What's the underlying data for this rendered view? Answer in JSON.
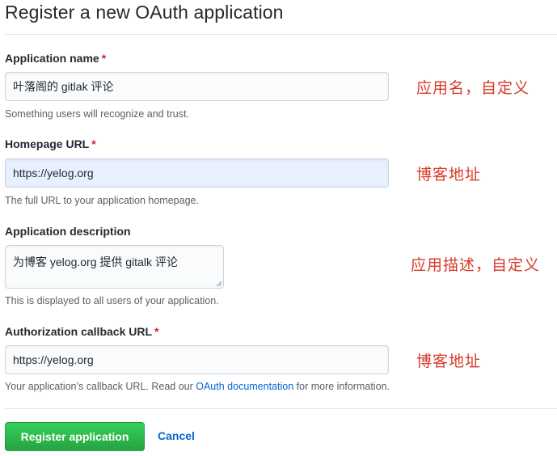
{
  "page": {
    "title": "Register a new OAuth application"
  },
  "form": {
    "required_mark": "*",
    "app_name": {
      "label": "Application name",
      "value": "叶落阁的 gitlak 评论",
      "note": "Something users will recognize and trust.",
      "annotation": "应用名，自定义"
    },
    "homepage_url": {
      "label": "Homepage URL",
      "value": "https://yelog.org",
      "note": "The full URL to your application homepage.",
      "annotation": "博客地址"
    },
    "description": {
      "label": "Application description",
      "value": "为博客 yelog.org 提供 gitalk 评论",
      "note": "This is displayed to all users of your application.",
      "annotation": "应用描述，自定义"
    },
    "callback_url": {
      "label": "Authorization callback URL",
      "value": "https://yelog.org",
      "note_before": "Your application’s callback URL. Read our ",
      "note_link": "OAuth documentation",
      "note_after": " for more information.",
      "annotation": "博客地址"
    }
  },
  "actions": {
    "register_label": "Register application",
    "cancel_label": "Cancel"
  },
  "colors": {
    "annotation": "#d73a28",
    "required": "#cb2431",
    "link": "#0366d6",
    "primary_button": "#28a745"
  }
}
